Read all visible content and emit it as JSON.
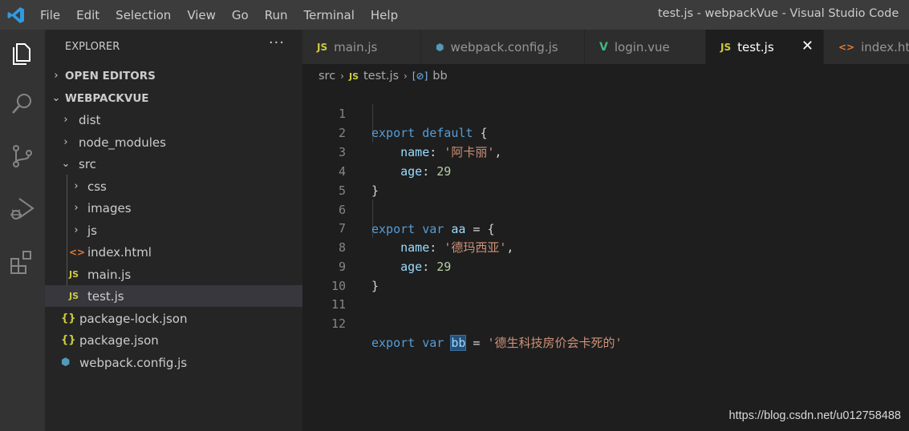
{
  "window": {
    "title": "test.js - webpackVue - Visual Studio Code",
    "menu": [
      "File",
      "Edit",
      "Selection",
      "View",
      "Go",
      "Run",
      "Terminal",
      "Help"
    ]
  },
  "activity_bar": {
    "items": [
      "explorer-icon",
      "search-icon",
      "source-control-icon",
      "run-debug-icon",
      "extensions-icon"
    ]
  },
  "explorer": {
    "title": "EXPLORER",
    "more": "···",
    "open_editors": "OPEN EDITORS",
    "root": "WEBPACKVUE",
    "tree": [
      {
        "label": "dist",
        "type": "folder",
        "chevron": "›"
      },
      {
        "label": "node_modules",
        "type": "folder",
        "chevron": "›"
      },
      {
        "label": "src",
        "type": "folder",
        "chevron": "⌄"
      },
      {
        "label": "css",
        "type": "folder",
        "chevron": "›"
      },
      {
        "label": "images",
        "type": "folder",
        "chevron": "›"
      },
      {
        "label": "js",
        "type": "folder",
        "chevron": "›"
      },
      {
        "label": "index.html",
        "type": "html",
        "icon": "<>"
      },
      {
        "label": "main.js",
        "type": "js",
        "icon": "JS"
      },
      {
        "label": "test.js",
        "type": "js",
        "icon": "JS"
      },
      {
        "label": "package-lock.json",
        "type": "json",
        "icon": "{}"
      },
      {
        "label": "package.json",
        "type": "json",
        "icon": "{}"
      },
      {
        "label": "webpack.config.js",
        "type": "webpack",
        "icon": "⬢"
      }
    ]
  },
  "tabs": [
    {
      "label": "main.js",
      "icon": "JS"
    },
    {
      "label": "webpack.config.js",
      "icon": "⬢"
    },
    {
      "label": "login.vue",
      "icon": "V"
    },
    {
      "label": "test.js",
      "icon": "JS",
      "close": "✕"
    },
    {
      "label": "index.html",
      "icon": "<>"
    }
  ],
  "breadcrumb": {
    "folder": "src",
    "file": "test.js",
    "file_icon": "JS",
    "symbol": "bb",
    "symbol_icon": "[⊘]"
  },
  "code": {
    "line_numbers": [
      "1",
      "2",
      "3",
      "4",
      "5",
      "6",
      "7",
      "8",
      "9",
      "10",
      "11",
      "12"
    ],
    "l1": {
      "kw1": "export",
      "kw2": "default",
      "punc": " {"
    },
    "l2": {
      "prop": "name",
      "colon": ": ",
      "str": "'阿卡丽'",
      "punc": ","
    },
    "l3": {
      "prop": "age",
      "colon": ": ",
      "num": "29"
    },
    "l4": {
      "punc": "}"
    },
    "l6": {
      "kw1": "export",
      "kw2": "var",
      "var": "aa",
      "punc": " = {"
    },
    "l7": {
      "prop": "name",
      "colon": ": ",
      "str": "'德玛西亚'",
      "punc": ","
    },
    "l8": {
      "prop": "age",
      "colon": ": ",
      "num": "29"
    },
    "l9": {
      "punc": "}"
    },
    "l12": {
      "kw1": "export",
      "kw2": "var",
      "var": "bb",
      "eq": " = ",
      "str": "'德生科技房价会卡死的'"
    }
  },
  "watermark": "https://blog.csdn.net/u012758488",
  "colors": {
    "keyword": "#569cd6",
    "string": "#ce9178",
    "number": "#b5cea8",
    "property": "#9cdcfe",
    "js_icon": "#cbcb41",
    "html_icon": "#e37933",
    "webpack_icon": "#519aba",
    "vue_icon": "#41b883"
  }
}
